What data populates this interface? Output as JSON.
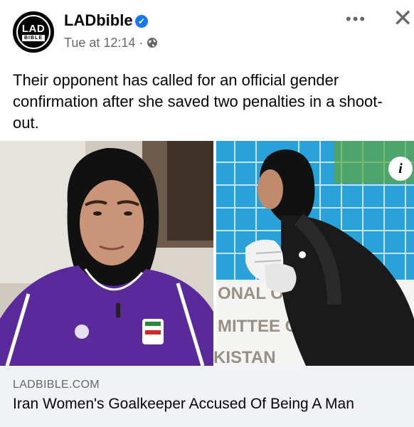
{
  "post": {
    "page_name": "LADbible",
    "time": "Tue at 12:14 ·",
    "caption": "Their opponent has called for an official gender confirmation after she saved two penalties in a shoot-out.",
    "logo_top": "LAD",
    "logo_bottom": "BIBLE"
  },
  "media": {
    "banner_lines": [
      "ONAL OL",
      "MITTEE OF",
      "KISTAN"
    ]
  },
  "link": {
    "domain": "LADBIBLE.COM",
    "title": "Iran Women's Goalkeeper Accused Of Being A Man"
  },
  "icons": {
    "verified": "verified-badge-icon",
    "globe": "globe-icon",
    "more": "more-options-icon",
    "close": "close-icon",
    "info": "info-icon"
  },
  "colors": {
    "accent": "#1877f2",
    "meta_text": "#65676b",
    "footer_bg": "#f0f2f5",
    "jersey_purple": "#5b2a9a"
  }
}
